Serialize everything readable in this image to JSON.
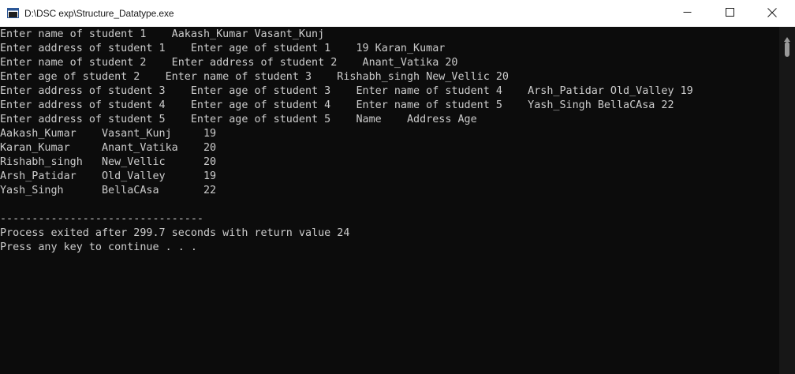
{
  "window": {
    "title": "D:\\DSC exp\\Structure_Datatype.exe"
  },
  "icons": {
    "app": "console-app-icon",
    "minimize": "minimize-icon",
    "maximize": "maximize-icon",
    "close": "close-icon",
    "scroll_up": "scroll-up-arrow-icon"
  },
  "colors": {
    "console_background": "#0c0c0c",
    "console_text": "#cccccc",
    "titlebar_background": "#ffffff"
  },
  "console": {
    "lines": [
      "Enter name of student 1    Aakash_Kumar Vasant_Kunj",
      "Enter address of student 1    Enter age of student 1    19 Karan_Kumar",
      "Enter name of student 2    Enter address of student 2    Anant_Vatika 20",
      "Enter age of student 2    Enter name of student 3    Rishabh_singh New_Vellic 20",
      "Enter address of student 3    Enter age of student 3    Enter name of student 4    Arsh_Patidar Old_Valley 19",
      "Enter address of student 4    Enter age of student 4    Enter name of student 5    Yash_Singh BellaCAsa 22",
      "Enter address of student 5    Enter age of student 5    Name    Address Age",
      "Aakash_Kumar    Vasant_Kunj     19",
      "Karan_Kumar     Anant_Vatika    20",
      "Rishabh_singh   New_Vellic      20",
      "Arsh_Patidar    Old_Valley      19",
      "Yash_Singh      BellaCAsa       22",
      "",
      "--------------------------------",
      "Process exited after 299.7 seconds with return value 24",
      "Press any key to continue . . ."
    ]
  }
}
